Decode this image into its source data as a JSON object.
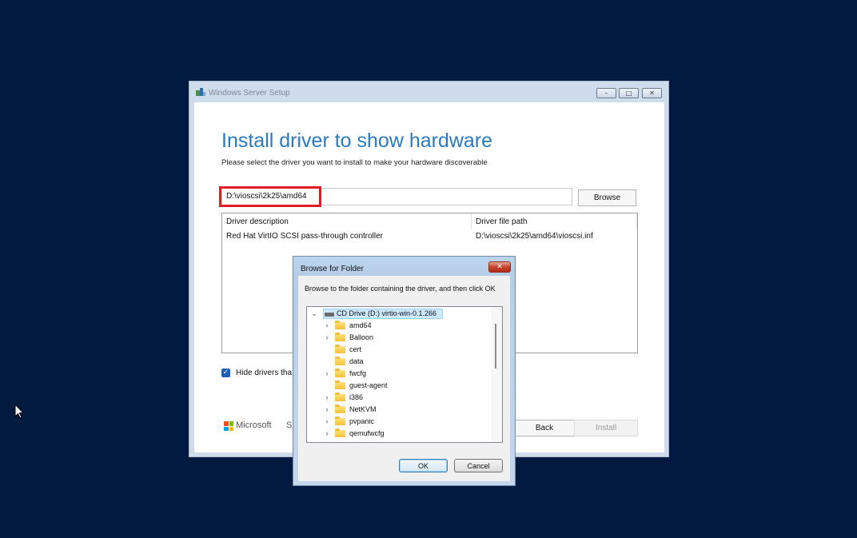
{
  "setup_window": {
    "title": "Windows Server Setup",
    "controls": {
      "minimize": "–",
      "maximize": "□",
      "close": "✕"
    },
    "heading": "Install driver to show hardware",
    "subtitle": "Please select the driver you want to install to make your hardware discoverable",
    "path_value": "D:\\vioscsi\\2k25\\amd64",
    "browse_label": "Browse",
    "table": {
      "columns": [
        "Driver description",
        "Driver file path"
      ],
      "rows": [
        [
          "Red Hat VirtIO SCSI pass-through controller",
          "D:\\vioscsi\\2k25\\amd64\\vioscsi.inf"
        ]
      ]
    },
    "hide_drivers_label": "Hide drivers tha",
    "hide_drivers_checked": true,
    "footer": {
      "brand": "Microsoft",
      "support_link": "S",
      "back_label": "Back",
      "install_label": "Install"
    },
    "colors": {
      "heading": "#2a7ac0",
      "highlight_border": "#e01c26",
      "desktop": "#021a3f"
    }
  },
  "browse_dialog": {
    "title": "Browse for Folder",
    "close_glyph": "✕",
    "instruction": "Browse to the folder containing the driver, and then click OK",
    "tree": {
      "root": "CD Drive (D:) virtio-win-0.1.266",
      "items": [
        {
          "label": "amd64",
          "expandable": true
        },
        {
          "label": "Balloon",
          "expandable": true
        },
        {
          "label": "cert",
          "expandable": false
        },
        {
          "label": "data",
          "expandable": false
        },
        {
          "label": "fwcfg",
          "expandable": true
        },
        {
          "label": "guest-agent",
          "expandable": false
        },
        {
          "label": "i386",
          "expandable": true
        },
        {
          "label": "NetKVM",
          "expandable": true
        },
        {
          "label": "pvpanic",
          "expandable": true
        },
        {
          "label": "qemufwcfg",
          "expandable": true
        }
      ]
    },
    "ok_label": "OK",
    "cancel_label": "Cancel"
  }
}
